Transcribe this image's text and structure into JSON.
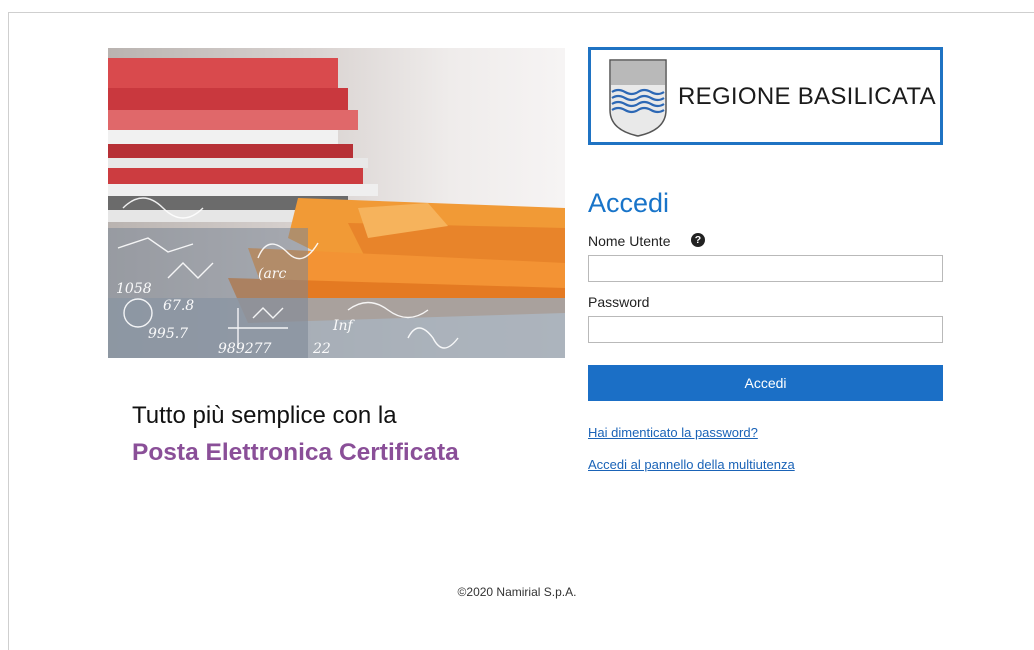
{
  "brand": {
    "name": "REGIONE BASILICATA",
    "color": "#1f73c3"
  },
  "tagline": {
    "line1": "Tutto più semplice con la",
    "line2": "Posta Elettronica Certificata",
    "accent_color": "#8a4f98"
  },
  "login": {
    "title": "Accedi",
    "username_label": "Nome Utente",
    "username_value": "",
    "help_icon": "question-circle-icon",
    "password_label": "Password",
    "password_value": "",
    "submit_label": "Accedi",
    "button_color": "#1b6fc6"
  },
  "links": {
    "forgot_password": "Hai dimenticato la password?",
    "multiuser_panel": "Accedi al pannello della multiutenza"
  },
  "footer": {
    "copyright": "©2020 Namirial S.p.A."
  }
}
